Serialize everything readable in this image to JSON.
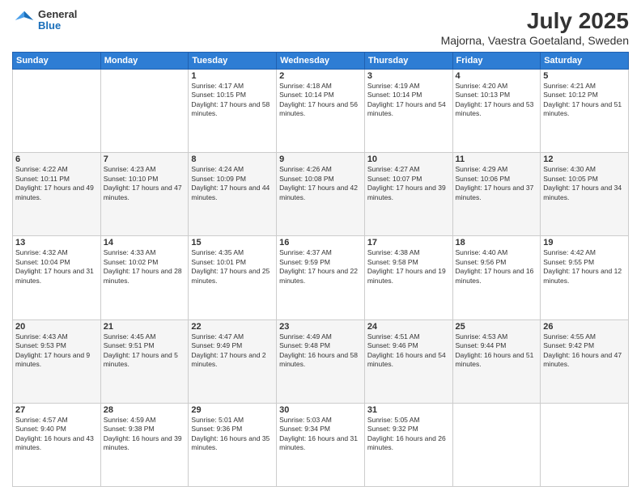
{
  "header": {
    "logo": {
      "line1": "General",
      "line2": "Blue"
    },
    "title": "July 2025",
    "subtitle": "Majorna, Vaestra Goetaland, Sweden"
  },
  "days_of_week": [
    "Sunday",
    "Monday",
    "Tuesday",
    "Wednesday",
    "Thursday",
    "Friday",
    "Saturday"
  ],
  "weeks": [
    [
      {
        "day": "",
        "info": ""
      },
      {
        "day": "",
        "info": ""
      },
      {
        "day": "1",
        "info": "Sunrise: 4:17 AM\nSunset: 10:15 PM\nDaylight: 17 hours and 58 minutes."
      },
      {
        "day": "2",
        "info": "Sunrise: 4:18 AM\nSunset: 10:14 PM\nDaylight: 17 hours and 56 minutes."
      },
      {
        "day": "3",
        "info": "Sunrise: 4:19 AM\nSunset: 10:14 PM\nDaylight: 17 hours and 54 minutes."
      },
      {
        "day": "4",
        "info": "Sunrise: 4:20 AM\nSunset: 10:13 PM\nDaylight: 17 hours and 53 minutes."
      },
      {
        "day": "5",
        "info": "Sunrise: 4:21 AM\nSunset: 10:12 PM\nDaylight: 17 hours and 51 minutes."
      }
    ],
    [
      {
        "day": "6",
        "info": "Sunrise: 4:22 AM\nSunset: 10:11 PM\nDaylight: 17 hours and 49 minutes."
      },
      {
        "day": "7",
        "info": "Sunrise: 4:23 AM\nSunset: 10:10 PM\nDaylight: 17 hours and 47 minutes."
      },
      {
        "day": "8",
        "info": "Sunrise: 4:24 AM\nSunset: 10:09 PM\nDaylight: 17 hours and 44 minutes."
      },
      {
        "day": "9",
        "info": "Sunrise: 4:26 AM\nSunset: 10:08 PM\nDaylight: 17 hours and 42 minutes."
      },
      {
        "day": "10",
        "info": "Sunrise: 4:27 AM\nSunset: 10:07 PM\nDaylight: 17 hours and 39 minutes."
      },
      {
        "day": "11",
        "info": "Sunrise: 4:29 AM\nSunset: 10:06 PM\nDaylight: 17 hours and 37 minutes."
      },
      {
        "day": "12",
        "info": "Sunrise: 4:30 AM\nSunset: 10:05 PM\nDaylight: 17 hours and 34 minutes."
      }
    ],
    [
      {
        "day": "13",
        "info": "Sunrise: 4:32 AM\nSunset: 10:04 PM\nDaylight: 17 hours and 31 minutes."
      },
      {
        "day": "14",
        "info": "Sunrise: 4:33 AM\nSunset: 10:02 PM\nDaylight: 17 hours and 28 minutes."
      },
      {
        "day": "15",
        "info": "Sunrise: 4:35 AM\nSunset: 10:01 PM\nDaylight: 17 hours and 25 minutes."
      },
      {
        "day": "16",
        "info": "Sunrise: 4:37 AM\nSunset: 9:59 PM\nDaylight: 17 hours and 22 minutes."
      },
      {
        "day": "17",
        "info": "Sunrise: 4:38 AM\nSunset: 9:58 PM\nDaylight: 17 hours and 19 minutes."
      },
      {
        "day": "18",
        "info": "Sunrise: 4:40 AM\nSunset: 9:56 PM\nDaylight: 17 hours and 16 minutes."
      },
      {
        "day": "19",
        "info": "Sunrise: 4:42 AM\nSunset: 9:55 PM\nDaylight: 17 hours and 12 minutes."
      }
    ],
    [
      {
        "day": "20",
        "info": "Sunrise: 4:43 AM\nSunset: 9:53 PM\nDaylight: 17 hours and 9 minutes."
      },
      {
        "day": "21",
        "info": "Sunrise: 4:45 AM\nSunset: 9:51 PM\nDaylight: 17 hours and 5 minutes."
      },
      {
        "day": "22",
        "info": "Sunrise: 4:47 AM\nSunset: 9:49 PM\nDaylight: 17 hours and 2 minutes."
      },
      {
        "day": "23",
        "info": "Sunrise: 4:49 AM\nSunset: 9:48 PM\nDaylight: 16 hours and 58 minutes."
      },
      {
        "day": "24",
        "info": "Sunrise: 4:51 AM\nSunset: 9:46 PM\nDaylight: 16 hours and 54 minutes."
      },
      {
        "day": "25",
        "info": "Sunrise: 4:53 AM\nSunset: 9:44 PM\nDaylight: 16 hours and 51 minutes."
      },
      {
        "day": "26",
        "info": "Sunrise: 4:55 AM\nSunset: 9:42 PM\nDaylight: 16 hours and 47 minutes."
      }
    ],
    [
      {
        "day": "27",
        "info": "Sunrise: 4:57 AM\nSunset: 9:40 PM\nDaylight: 16 hours and 43 minutes."
      },
      {
        "day": "28",
        "info": "Sunrise: 4:59 AM\nSunset: 9:38 PM\nDaylight: 16 hours and 39 minutes."
      },
      {
        "day": "29",
        "info": "Sunrise: 5:01 AM\nSunset: 9:36 PM\nDaylight: 16 hours and 35 minutes."
      },
      {
        "day": "30",
        "info": "Sunrise: 5:03 AM\nSunset: 9:34 PM\nDaylight: 16 hours and 31 minutes."
      },
      {
        "day": "31",
        "info": "Sunrise: 5:05 AM\nSunset: 9:32 PM\nDaylight: 16 hours and 26 minutes."
      },
      {
        "day": "",
        "info": ""
      },
      {
        "day": "",
        "info": ""
      }
    ]
  ]
}
